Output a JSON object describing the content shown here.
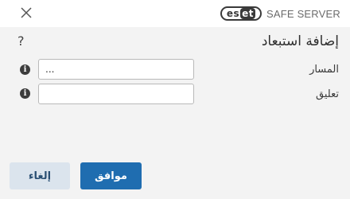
{
  "titlebar": {
    "close_icon": "close-icon",
    "brand_logo": "eset",
    "product": "SAFE SERVER"
  },
  "dialog": {
    "title": "إضافة استبعاد",
    "help_icon": "help-icon"
  },
  "form": {
    "path_label": "المسار",
    "path_value": "...",
    "comment_label": "تعليق",
    "comment_value": ""
  },
  "buttons": {
    "ok_label": "موافق",
    "cancel_label": "إلغاء"
  },
  "colors": {
    "primary": "#1f6db0",
    "secondary": "#dbe4ed",
    "background": "#f3f3f3"
  }
}
